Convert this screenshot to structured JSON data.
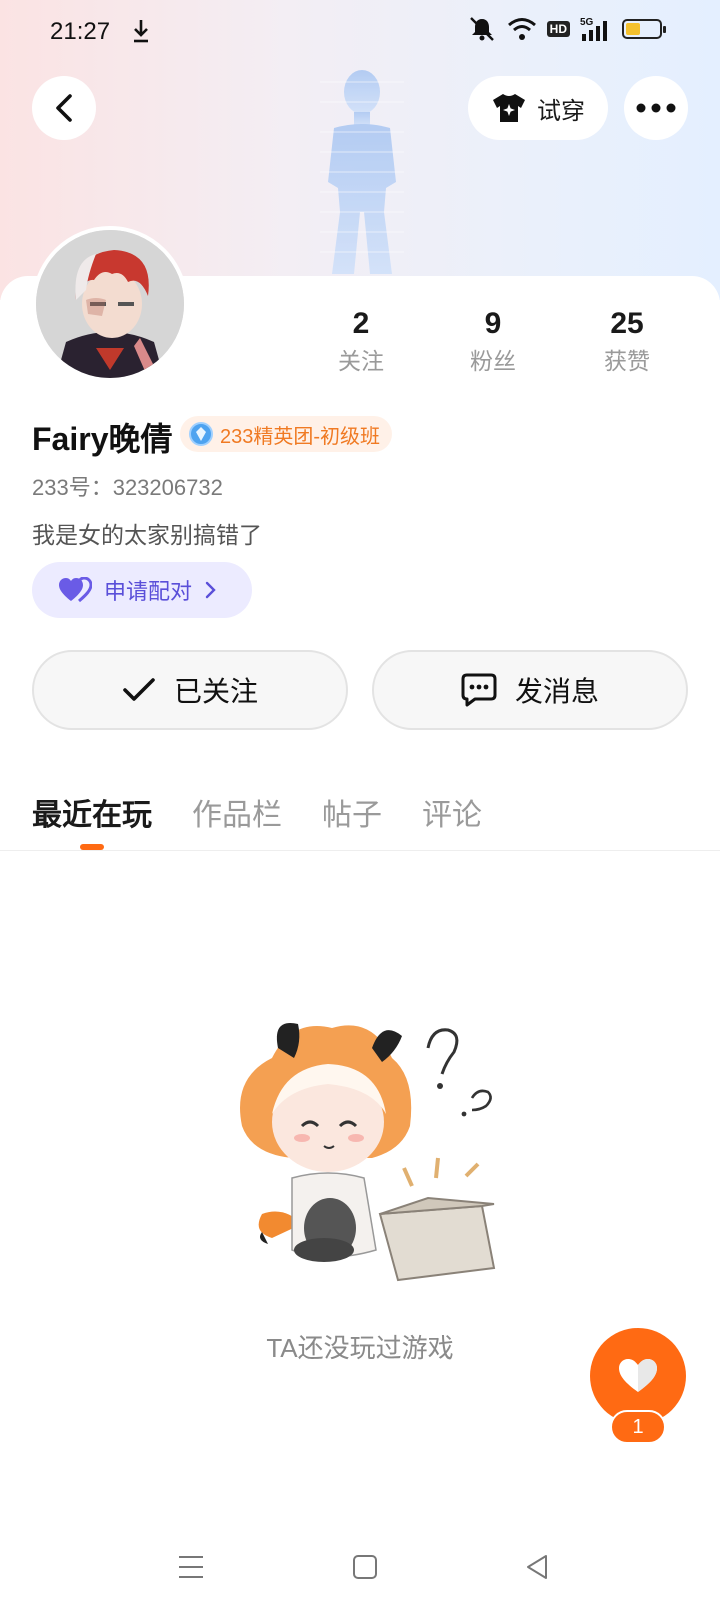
{
  "status_bar": {
    "time": "21:27",
    "icons": [
      "download-icon",
      "mute-icon",
      "wifi-icon",
      "hd-icon",
      "signal-5g-icon",
      "battery-icon"
    ],
    "hd_label": "HD",
    "network_label": "5G"
  },
  "header": {
    "try_on_label": "试穿"
  },
  "profile": {
    "stats": [
      {
        "value": "2",
        "label": "关注"
      },
      {
        "value": "9",
        "label": "粉丝"
      },
      {
        "value": "25",
        "label": "获赞"
      }
    ],
    "nickname": "Fairy晚倩",
    "badge_label": "233精英团-初级班",
    "uid": "233号：323206732",
    "bio": "我是女的太家别搞错了",
    "pair_label": "申请配对"
  },
  "actions": {
    "follow_label": "已关注",
    "message_label": "发消息"
  },
  "tabs": [
    {
      "label": "最近在玩",
      "active": true
    },
    {
      "label": "作品栏",
      "active": false
    },
    {
      "label": "帖子",
      "active": false
    },
    {
      "label": "评论",
      "active": false
    }
  ],
  "empty_state": {
    "text": "TA还没玩过游戏"
  },
  "like_fab": {
    "count": "1"
  },
  "colors": {
    "accent": "#ff6a13",
    "pair_text": "#5a4fd9",
    "pair_bg": "#ecebff",
    "badge_text": "#f07a23"
  }
}
